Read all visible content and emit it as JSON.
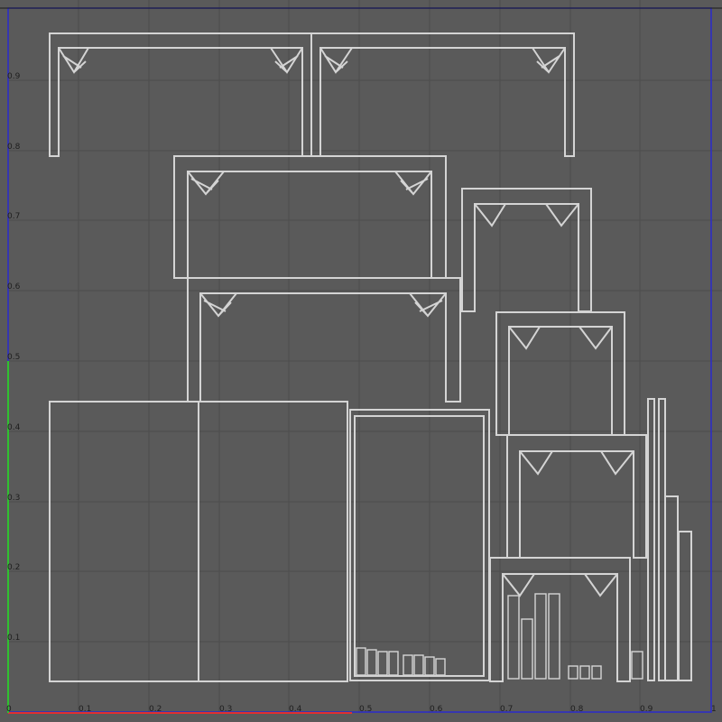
{
  "editor": {
    "view": "UV Editor",
    "axes": {
      "u_axis_color": "#e03030",
      "v_axis_color": "#30c030",
      "border_color": "#2a2acc",
      "u_ticks": [
        "0",
        "0.1",
        "0.2",
        "0.3",
        "0.4",
        "0.5",
        "0.6",
        "0.7",
        "0.8",
        "0.9",
        "1"
      ],
      "v_ticks": [
        "0.1",
        "0.2",
        "0.3",
        "0.4",
        "0.5",
        "0.6",
        "0.7",
        "0.8",
        "0.9"
      ]
    },
    "colors": {
      "background": "#5a5a5a",
      "grid": "#4c4c4c",
      "wireframe": "#d4d4d4",
      "tick_label": "#1e1e1e"
    }
  }
}
